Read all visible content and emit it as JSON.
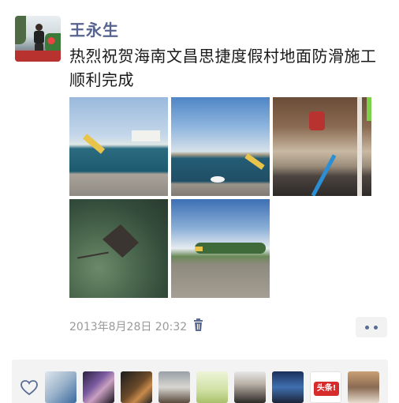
{
  "post": {
    "username": "王永生",
    "text": "热烈祝贺海南文昌思捷度假村地面防滑施工顺利完成",
    "timestamp": "2013年8月28日 20:32",
    "photos": [
      "photo-1",
      "photo-2",
      "photo-3",
      "photo-4",
      "photo-5"
    ]
  },
  "likes": {
    "news_badge": "头条!"
  },
  "icons": {
    "delete": "trash-icon",
    "more": "more-dots-icon",
    "like": "heart-icon"
  },
  "colors": {
    "username": "#56648f",
    "text": "#1a1a1a",
    "timestamp": "#9a9a9a",
    "likes_bg": "#f3f3f3"
  }
}
